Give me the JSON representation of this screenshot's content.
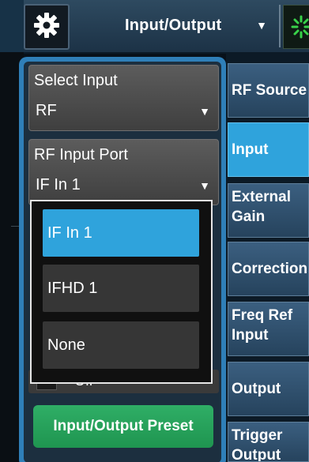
{
  "header": {
    "menu_title": "Input/Output",
    "menu_arrow": "▼",
    "settings_icon": "gear-icon",
    "sweep_icon": "sweep-spinner-icon"
  },
  "select_input": {
    "label": "Select Input",
    "value": "RF",
    "arrow": "▼"
  },
  "rf_input_port": {
    "label": "RF Input Port",
    "value": "IF In 1",
    "arrow": "▼"
  },
  "dropdown": {
    "options": [
      "IF In 1",
      "IFHD 1",
      "None"
    ],
    "selected": "IF In 1"
  },
  "partial_toggle": {
    "label": "Off"
  },
  "preset_button": {
    "label": "Input/Output Preset"
  },
  "softkeys": [
    {
      "label_1": "RF Source",
      "label_2": ""
    },
    {
      "label_1": "Input",
      "label_2": ""
    },
    {
      "label_1": "External",
      "label_2": "Gain"
    },
    {
      "label_1": "Corrections",
      "label_2": ""
    },
    {
      "label_1": "Freq Ref",
      "label_2": "Input"
    },
    {
      "label_1": "Output",
      "label_2": ""
    },
    {
      "label_1": "Trigger",
      "label_2": "Output"
    }
  ],
  "colors": {
    "accent_blue": "#2fa3dc",
    "preset_green": "#1f9550",
    "panel_border": "#2f7fb8"
  }
}
